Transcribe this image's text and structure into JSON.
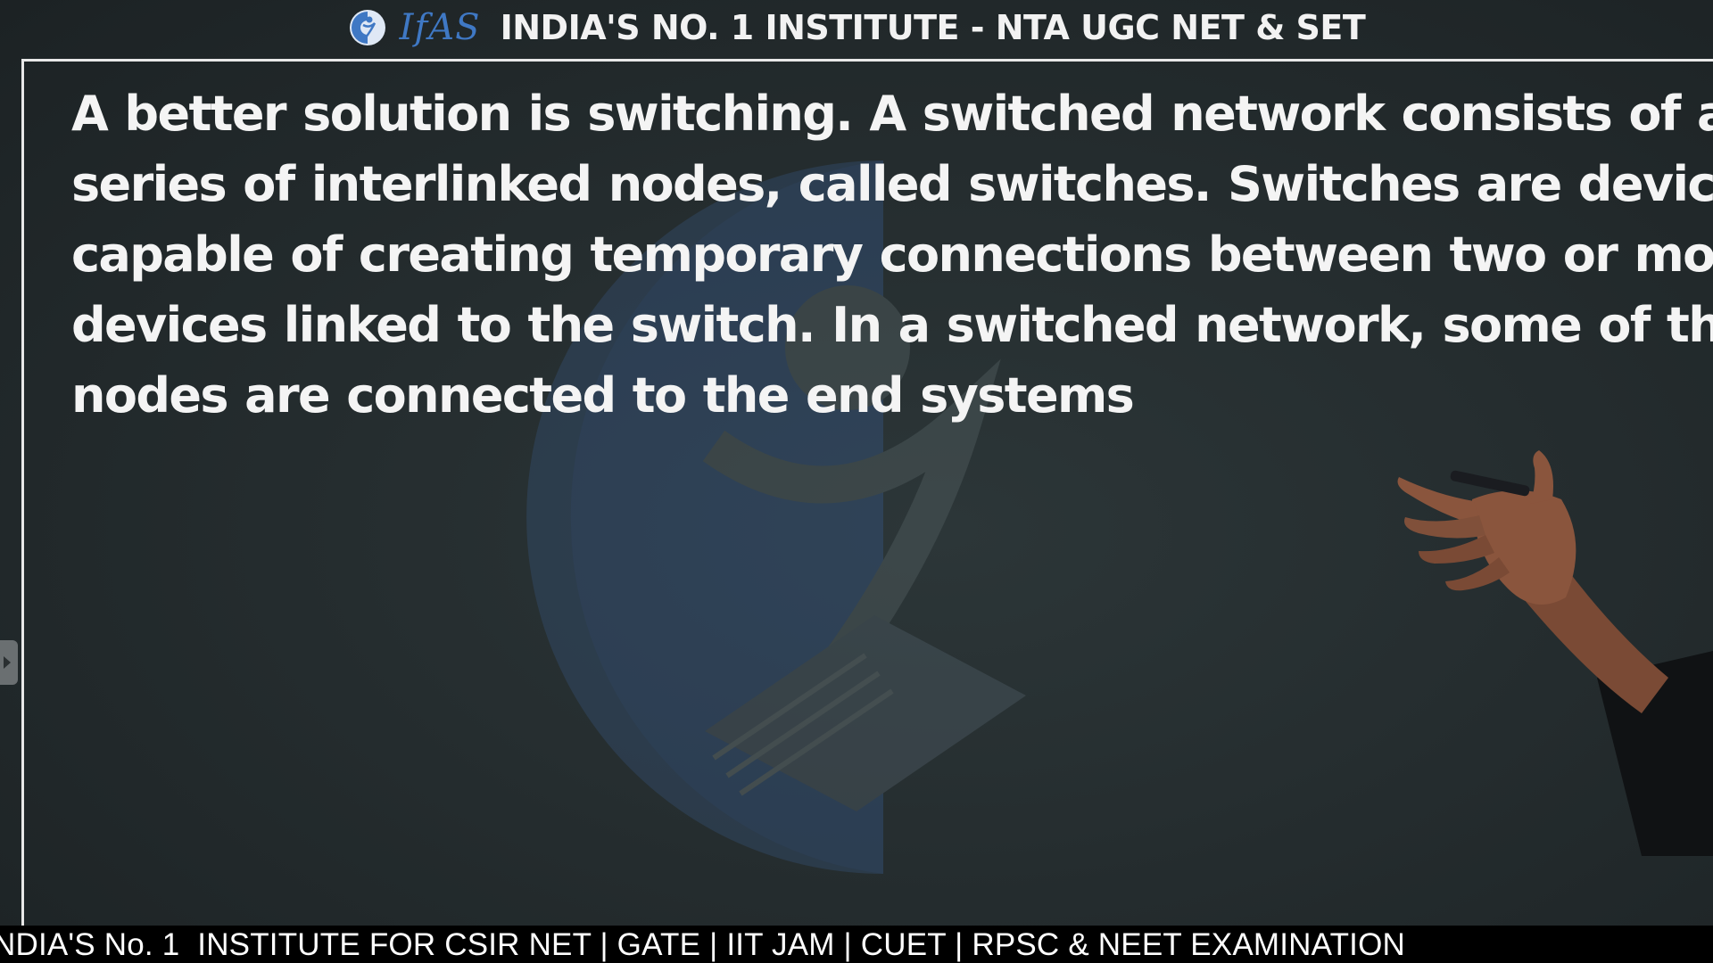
{
  "banner": {
    "logo_icon": "ifas-circle-logo",
    "brand": "IfAS",
    "title": "INDIA'S NO. 1 INSTITUTE - NTA UGC NET & SET"
  },
  "slide": {
    "lines": [
      "A better solution is switching. A switched network consists of a",
      "series of interlinked nodes, called switches. Switches are devices",
      "capable of creating temporary connections between two or more",
      "devices linked to the switch. In a switched network, some of these",
      "nodes are connected to the end systems"
    ]
  },
  "ticker": {
    "text": "NDIA'S No. 1  INSTITUTE FOR CSIR NET | GATE | IIT JAM | CUET | RPSC & NEET EXAMINATION"
  },
  "colors": {
    "board": "#252d2f",
    "text": "#f4f4f4",
    "brand_blue": "#3f78c4",
    "ticker_bg": "#000000"
  }
}
